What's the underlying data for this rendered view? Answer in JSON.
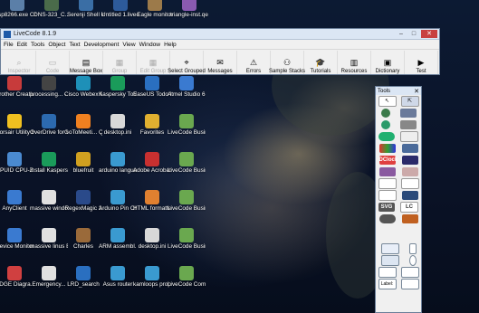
{
  "desktop": {
    "top_icons": [
      {
        "label": "sp8266.exe Copy",
        "color": "#5b7fa8"
      },
      {
        "label": "DNS-323_C...",
        "color": "#4a6b4a"
      },
      {
        "label": "Serenji Shell in local C...",
        "color": "#3a6ea5"
      },
      {
        "label": "Untitled 1.livecode",
        "color": "#2d5a9a"
      },
      {
        "label": "Eagle monitor",
        "color": "#9c7a4a"
      },
      {
        "label": "triangle-inst.qec",
        "color": "#8a5ab0"
      }
    ],
    "rows": [
      [
        {
          "label": "Brother Creative...",
          "color": "#c73b3b"
        },
        {
          "label": "processing... - Shortcut",
          "color": "#444"
        },
        {
          "label": "Cisco Webex Meetings",
          "color": "#1e90b8"
        },
        {
          "label": "Kaspersky Total Se...",
          "color": "#1a9b5a"
        },
        {
          "label": "EaseUS Todo Backup Ho...",
          "color": "#2a6fc0"
        },
        {
          "label": "Atmel Studio 6.2",
          "color": "#3a7ad0"
        }
      ],
      [
        {
          "label": "Corsair Utility Engine",
          "color": "#f0c020"
        },
        {
          "label": "OverDrive for Windows",
          "color": "#2c6ab0"
        },
        {
          "label": "GoToMeeti... Quick Con...",
          "color": "#f08020"
        },
        {
          "label": "desktop.ini",
          "color": "#d8d8d8"
        },
        {
          "label": "Favorites",
          "color": "#e0b030"
        },
        {
          "label": "LiveCode Business 9.5",
          "color": "#6aa84f"
        }
      ],
      [
        {
          "label": "CPUID CPU-Z",
          "color": "#4a8ad0"
        },
        {
          "label": "Install Kaspers...",
          "color": "#1a9b5a"
        },
        {
          "label": "bluefruit",
          "color": "#d0a020"
        },
        {
          "label": "arduino langua...",
          "color": "#3a9ad0"
        },
        {
          "label": "Adobe Acrobat...",
          "color": "#c83030"
        },
        {
          "label": "LiveCode Busines...",
          "color": "#6aa84f"
        }
      ],
      [
        {
          "label": "AnyClient",
          "color": "#3a7ad0"
        },
        {
          "label": "massive windows E...",
          "color": "#e0e0e0"
        },
        {
          "label": "RegexMagic 2",
          "color": "#2a4a8a"
        },
        {
          "label": "Arduino Pin Change Int...",
          "color": "#3a9ad0"
        },
        {
          "label": "HTML formatter",
          "color": "#e08030"
        },
        {
          "label": "LiveCode Business 8.1.9",
          "color": "#6aa84f"
        }
      ],
      [
        {
          "label": "Device Monitori...",
          "color": "#3a7ad0"
        },
        {
          "label": "massive linus Emergency...",
          "color": "#e0e0e0"
        },
        {
          "label": "Charles",
          "color": "#9a6a3a"
        },
        {
          "label": "ARM assembl...",
          "color": "#3a9ad0"
        },
        {
          "label": "desktop.ini",
          "color": "#d8d8d8"
        },
        {
          "label": "LiveCode Busines...",
          "color": "#6aa84f"
        }
      ],
      [
        {
          "label": "EDGE Diagra...",
          "color": "#d04040"
        },
        {
          "label": "Emergency...",
          "color": "#e0e0e0"
        },
        {
          "label": "LRD_search",
          "color": "#2a6fc0"
        },
        {
          "label": "Asus router",
          "color": "#3a9ad0"
        },
        {
          "label": "kamloops property info",
          "color": "#3a9ad0"
        },
        {
          "label": "LiveCode Communi...",
          "color": "#6aa84f"
        }
      ]
    ]
  },
  "livecode": {
    "title": "LiveCode 8.1.9",
    "menu": [
      "File",
      "Edit",
      "Tools",
      "Object",
      "Text",
      "Development",
      "View",
      "Window",
      "Help"
    ],
    "toolbar": [
      {
        "label": "Inspector",
        "icon": "inspector-icon",
        "glyph": "⌕",
        "enabled": false
      },
      {
        "label": "Code",
        "icon": "code-icon",
        "glyph": "▭",
        "enabled": false
      },
      {
        "label": "Message Box",
        "icon": "message-box-icon",
        "glyph": "▤",
        "enabled": true
      },
      {
        "label": "Group",
        "icon": "group-icon",
        "glyph": "▦",
        "enabled": false
      },
      {
        "label": "Edit Group",
        "icon": "edit-group-icon",
        "glyph": "▦",
        "enabled": false
      },
      {
        "label": "Select Grouped",
        "icon": "select-grouped-icon",
        "glyph": "⌖",
        "enabled": true
      },
      {
        "label": "Messages",
        "icon": "messages-icon",
        "glyph": "✉",
        "enabled": true
      },
      {
        "label": "Errors",
        "icon": "errors-icon",
        "glyph": "⚠",
        "enabled": true
      },
      {
        "label": "Sample Stacks",
        "icon": "sample-stacks-icon",
        "glyph": "⚇",
        "enabled": true
      },
      {
        "label": "Tutorials",
        "icon": "tutorials-icon",
        "glyph": "🎓",
        "enabled": true
      },
      {
        "label": "Resources",
        "icon": "resources-icon",
        "glyph": "▥",
        "enabled": true
      },
      {
        "label": "Dictionary",
        "icon": "dictionary-icon",
        "glyph": "▣",
        "enabled": true
      },
      {
        "label": "Test",
        "icon": "test-icon",
        "glyph": "▶",
        "enabled": true
      }
    ]
  },
  "tools_palette": {
    "title": "Tools",
    "labels": [
      "DClock",
      "SVG",
      "LC",
      "Label:"
    ]
  }
}
